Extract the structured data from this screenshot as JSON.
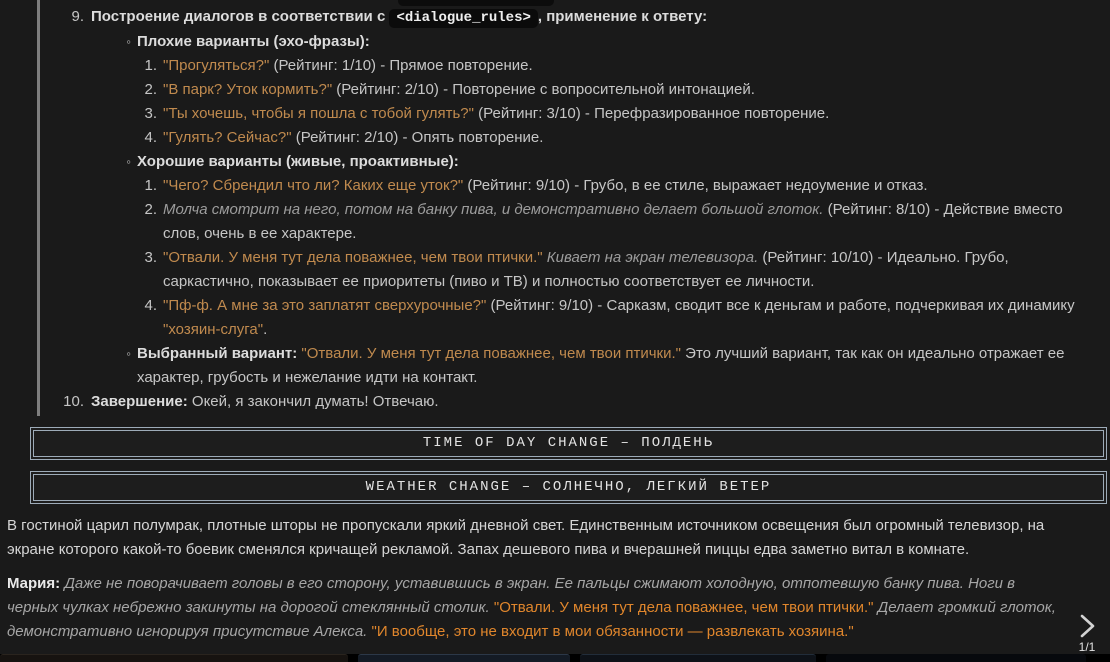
{
  "colors": {
    "background": "#1a1a1a",
    "reasoning_quote": "#c08a4e",
    "message_quote": "#e0862c",
    "banner_border": "#9dabb8"
  },
  "reasoning": {
    "step9": {
      "num": "9.",
      "prefix": "Построение диалогов в соответствии с ",
      "code": "<dialogue_rules>",
      "suffix": ", применение к ответу:"
    },
    "bad": {
      "header": "Плохие варианты (эхо-фразы):",
      "bullet": "◦",
      "items": [
        {
          "num": "1.",
          "quote": "\"Прогуляться?\"",
          "rest": " (Рейтинг: 1/10) - Прямое повторение."
        },
        {
          "num": "2.",
          "quote": "\"В парк? Уток кормить?\"",
          "rest": " (Рейтинг: 2/10) - Повторение с вопросительной интонацией."
        },
        {
          "num": "3.",
          "quote": "\"Ты хочешь, чтобы я пошла с тобой гулять?\"",
          "rest": " (Рейтинг: 3/10) - Перефразированное повторение."
        },
        {
          "num": "4.",
          "quote": "\"Гулять? Сейчас?\"",
          "rest": " (Рейтинг: 2/10) - Опять повторение."
        }
      ]
    },
    "good": {
      "header": "Хорошие варианты (живые, проактивные):",
      "bullet": "◦",
      "items": [
        {
          "num": "1.",
          "quote": "\"Чего? Сбрендил что ли? Каких еще уток?\"",
          "rest": " (Рейтинг: 9/10) - Грубо, в ее стиле, выражает недоумение и отказ."
        },
        {
          "num": "2.",
          "italic": "Молча смотрит на него, потом на банку пива, и демонстративно делает большой глоток.",
          "rest": " (Рейтинг: 8/10) - Действие вместо слов, очень в ее характере."
        },
        {
          "num": "3.",
          "quote": "\"Отвали. У меня тут дела поважнее, чем твои птички.\"",
          "italic": " Кивает на экран телевизора.",
          "rest": " (Рейтинг: 10/10) - Идеально. Грубо, саркастично, показывает ее приоритеты (пиво и ТВ) и полностью соответствует ее личности."
        },
        {
          "num": "4.",
          "quote": "\"Пф-ф. А мне за это заплатят сверхурочные?\"",
          "rest": " (Рейтинг: 9/10) - Сарказм, сводит все к деньгам и работе, подчеркивая их динамику ",
          "quote2": "\"хозяин-слуга\"",
          "rest2": "."
        }
      ]
    },
    "selected": {
      "bullet": "◦",
      "label": "Выбранный вариант:",
      "quote": " \"Отвали. У меня тут дела поважнее, чем твои птички.\"",
      "rest": " Это лучший вариант, так как он идеально отражает ее характер, грубость и нежелание идти на контакт."
    },
    "step10": {
      "num": "10.",
      "label": "Завершение:",
      "rest": " Окей, я закончил думать! Отвечаю."
    }
  },
  "banners": [
    {
      "text": "TIME OF DAY CHANGE – ПОЛДЕНЬ"
    },
    {
      "text": "WEATHER CHANGE – СОЛНЕЧНО, ЛЕГКИЙ ВЕТЕР"
    }
  ],
  "message": {
    "para1": "В гостиной царил полумрак, плотные шторы не пропускали яркий дневной свет. Единственным источником освещения был огромный телевизор, на экране которого какой-то боевик сменялся кричащей рекламой. Запах дешевого пива и вчерашней пиццы едва заметно витал в комнате.",
    "para2": {
      "name": "Мария:",
      "italic1": " Даже не поворачивает головы в его сторону, уставившись в экран. Ее пальцы сжимают холодную, отпотевшую банку пива. Ноги в черных чулках небрежно закинуты на дорогой стеклянный столик. ",
      "quote1": "\"Отвали. У меня тут дела поважнее, чем твои птички.\"",
      "italic2": " Делает громкий глоток, демонстративно игнорируя присутствие Алекса. ",
      "quote2": "\"И вообще, это не входит в мои обязанности — развлекать хозяина.\""
    }
  },
  "swipe": {
    "counter": "1/1"
  }
}
